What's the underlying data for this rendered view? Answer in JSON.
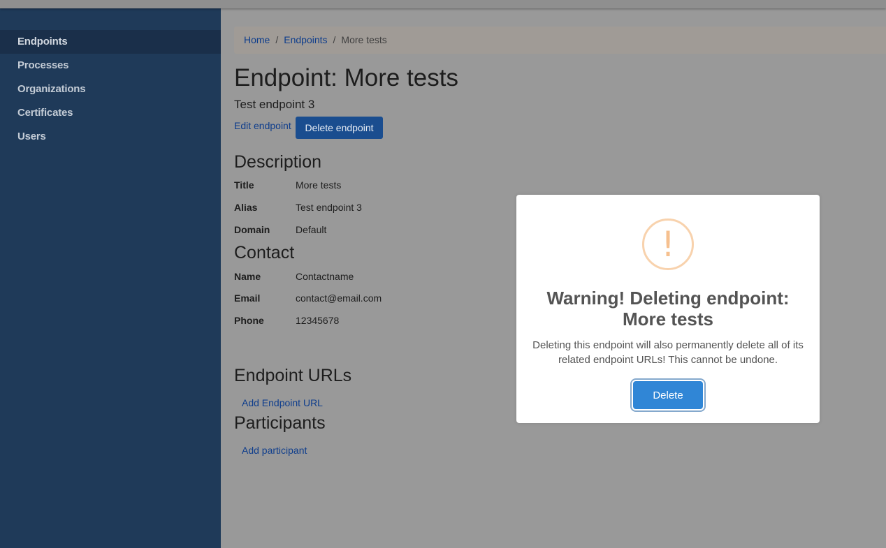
{
  "sidebar": {
    "items": [
      {
        "label": "Endpoints"
      },
      {
        "label": "Processes"
      },
      {
        "label": "Organizations"
      },
      {
        "label": "Certificates"
      },
      {
        "label": "Users"
      }
    ]
  },
  "breadcrumb": {
    "home": "Home",
    "endpoints": "Endpoints",
    "current": "More tests",
    "separator": "/"
  },
  "page": {
    "title": "Endpoint: More tests",
    "subtitle": "Test endpoint 3",
    "edit_link": "Edit endpoint",
    "delete_button": "Delete endpoint"
  },
  "description": {
    "heading": "Description",
    "rows": [
      {
        "key": "Title",
        "value": "More tests"
      },
      {
        "key": "Alias",
        "value": "Test endpoint 3"
      },
      {
        "key": "Domain",
        "value": "Default"
      }
    ]
  },
  "contact": {
    "heading": "Contact",
    "rows": [
      {
        "key": "Name",
        "value": "Contactname"
      },
      {
        "key": "Email",
        "value": "contact@email.com"
      },
      {
        "key": "Phone",
        "value": "12345678"
      }
    ]
  },
  "endpoint_urls": {
    "heading": "Endpoint URLs",
    "add_link": "Add Endpoint URL"
  },
  "participants": {
    "heading": "Participants",
    "add_link": "Add participant"
  },
  "modal": {
    "icon": "!",
    "title_line1": "Warning! Deleting endpoint:",
    "title_line2": "More tests",
    "text": "Deleting this endpoint will also permanently delete all of its related endpoint URLs! This cannot be undone.",
    "confirm_button": "Delete"
  }
}
